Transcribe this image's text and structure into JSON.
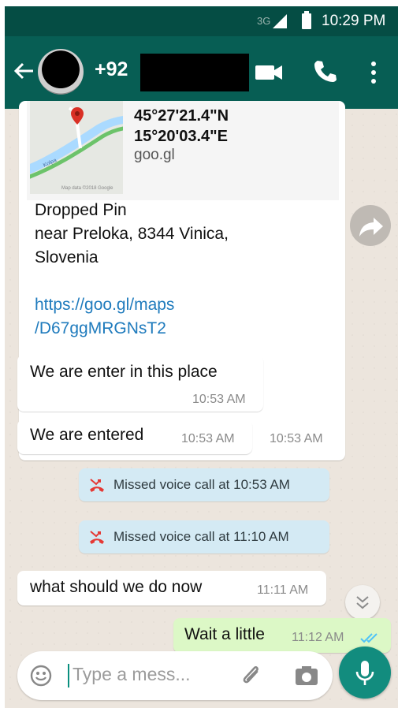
{
  "status_bar": {
    "network": "3G",
    "time": "10:29 PM"
  },
  "header": {
    "contact_prefix": "+92"
  },
  "location_message": {
    "lat": "45°27'21.4\"N",
    "lon": "15°20'03.4\"E",
    "domain": "goo.gl",
    "map_credit": "Map data ©2018 Google",
    "map_road_label": "Kolpa",
    "line1": "Dropped Pin",
    "line2": "near Preloka, 8344 Vinica,",
    "line3": "Slovenia",
    "link1": "https://goo.gl/maps",
    "link2": "/D67ggMRGNsT2",
    "time": "10:53 AM"
  },
  "messages": [
    {
      "text": "We are enter in this place",
      "time": "10:53 AM"
    },
    {
      "text": "We are entered",
      "time": "10:53 AM"
    },
    {
      "text": "what should we do now",
      "time": "11:11 AM"
    }
  ],
  "system": [
    {
      "text": "Missed voice call at 10:53 AM"
    },
    {
      "text": "Missed voice call at 11:10 AM"
    }
  ],
  "outgoing": {
    "text": "Wait a little",
    "time": "11:12 AM"
  },
  "input": {
    "placeholder": "Type a mess..."
  },
  "colors": {
    "header": "#075e54",
    "status": "#054d44",
    "accent": "#128c7e",
    "chat_bg": "#ece5dd",
    "link": "#1f7bbd"
  }
}
